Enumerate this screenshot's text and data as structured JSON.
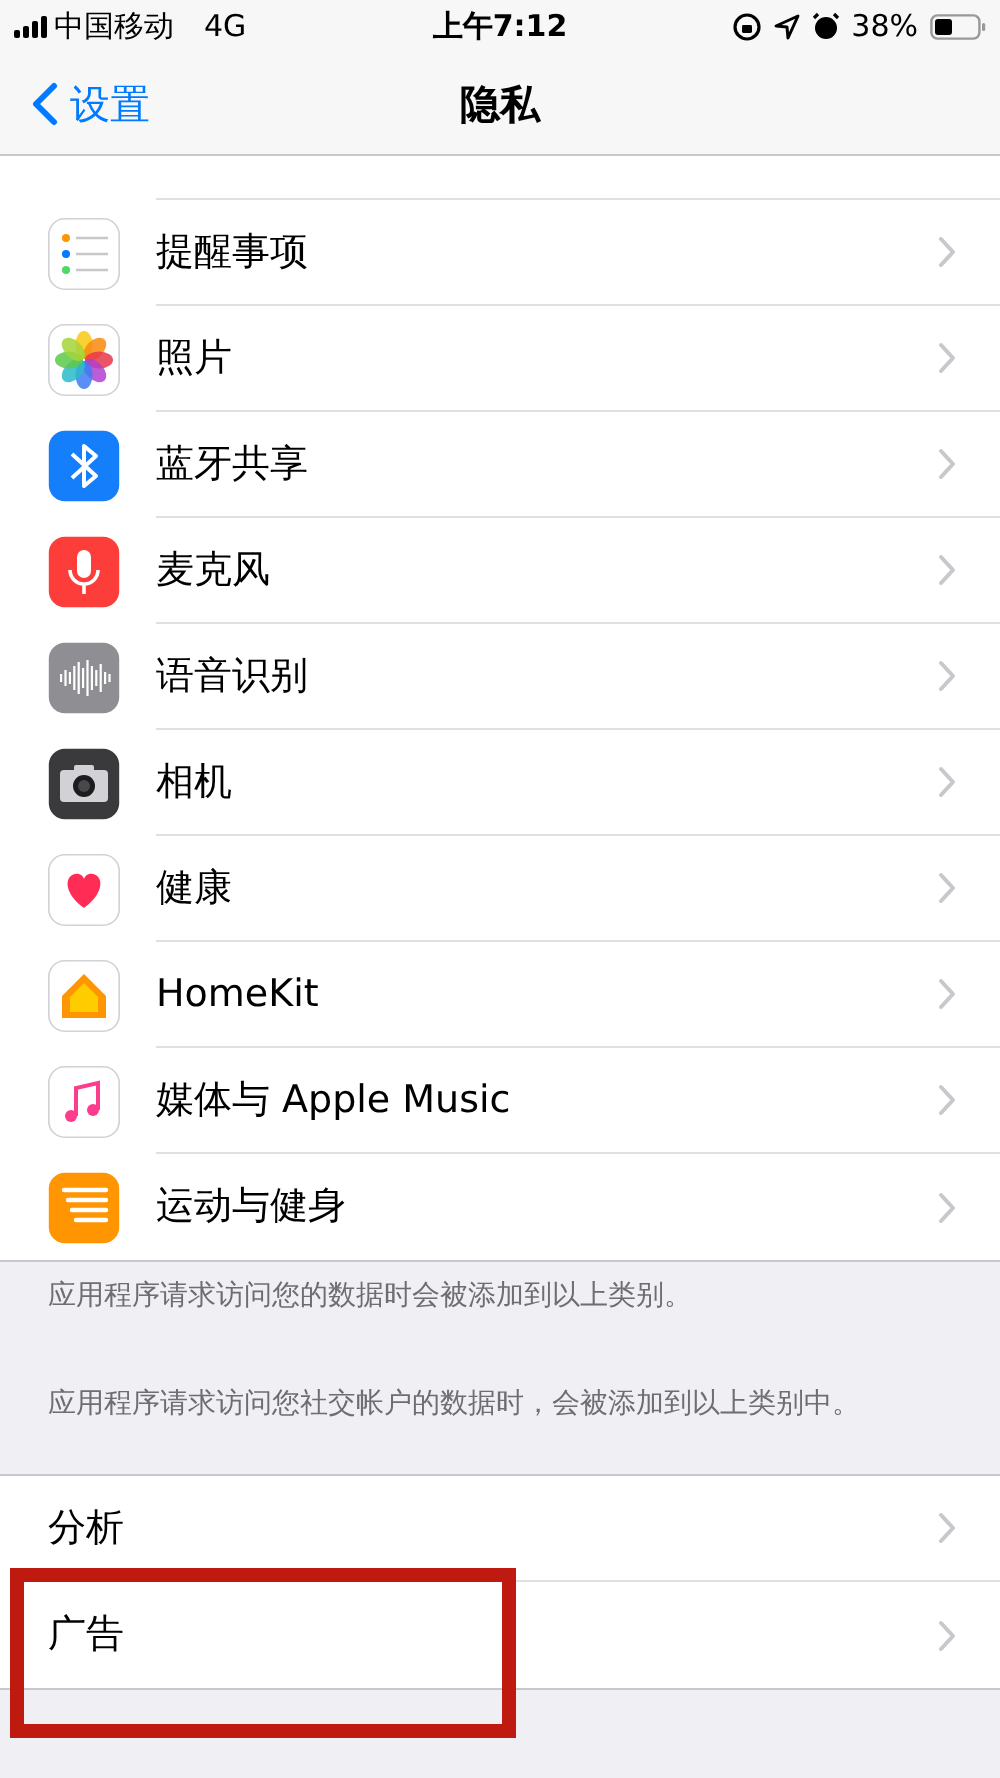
{
  "status_bar": {
    "carrier": "中国移动",
    "network": "4G",
    "time": "上午7:12",
    "battery": "38%"
  },
  "nav": {
    "back": "设置",
    "title": "隐私"
  },
  "rows": [
    {
      "kind": "reminders",
      "label": "提醒事项"
    },
    {
      "kind": "photos",
      "label": "照片"
    },
    {
      "kind": "bluetooth",
      "label": "蓝牙共享"
    },
    {
      "kind": "microphone",
      "label": "麦克风"
    },
    {
      "kind": "speech",
      "label": "语音识别"
    },
    {
      "kind": "camera",
      "label": "相机"
    },
    {
      "kind": "health",
      "label": "健康"
    },
    {
      "kind": "homekit",
      "label": "HomeKit"
    },
    {
      "kind": "music",
      "label": "媒体与 Apple Music"
    },
    {
      "kind": "fitness",
      "label": "运动与健身"
    }
  ],
  "footnotes": [
    "应用程序请求访问您的数据时会被添加到以上类别。",
    "应用程序请求访问您社交帐户的数据时，会被添加到以上类别中。"
  ],
  "bottom_rows": [
    {
      "label": "分析",
      "highlighted": false
    },
    {
      "label": "广告",
      "highlighted": true
    }
  ]
}
